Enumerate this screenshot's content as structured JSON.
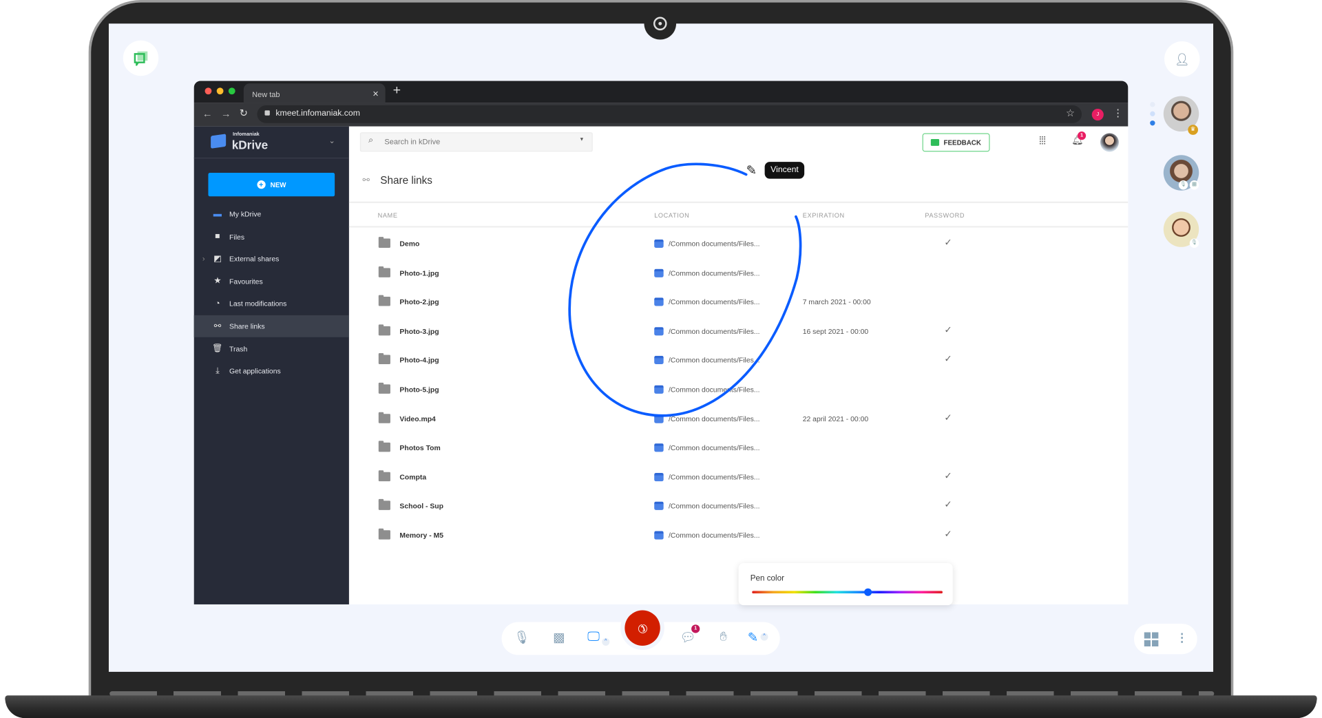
{
  "browser": {
    "tab_title": "New tab",
    "url": "kmeet.infomaniak.com",
    "profile_initial": "J"
  },
  "sidebar": {
    "brand_small": "Infomaniak",
    "brand": "kDrive",
    "new_label": "NEW",
    "items": [
      {
        "label": "My kDrive",
        "icon": "drive-icon"
      },
      {
        "label": "Files",
        "icon": "folder-icon"
      },
      {
        "label": "External shares",
        "icon": "shared-folder-icon"
      },
      {
        "label": "Favourites",
        "icon": "star-icon"
      },
      {
        "label": "Last modifications",
        "icon": "clock-icon"
      },
      {
        "label": "Share links",
        "icon": "link-icon",
        "active": true
      },
      {
        "label": "Trash",
        "icon": "trash-icon"
      },
      {
        "label": "Get applications",
        "icon": "download-icon"
      }
    ]
  },
  "header": {
    "search_placeholder": "Search in kDrive",
    "feedback_label": "FEEDBACK",
    "notification_count": "1"
  },
  "page": {
    "title": "Share links",
    "columns": [
      "NAME",
      "LOCATION",
      "EXPIRATION",
      "PASSWORD"
    ],
    "rows": [
      {
        "name": "Demo",
        "location": "/Common documents/Files...",
        "expiration": "",
        "password": true
      },
      {
        "name": "Photo-1.jpg",
        "location": "/Common documents/Files...",
        "expiration": "",
        "password": false
      },
      {
        "name": "Photo-2.jpg",
        "location": "/Common documents/Files...",
        "expiration": "7 march 2021 - 00:00",
        "password": false
      },
      {
        "name": "Photo-3.jpg",
        "location": "/Common documents/Files...",
        "expiration": "16 sept 2021 - 00:00",
        "password": true
      },
      {
        "name": "Photo-4.jpg",
        "location": "/Common documents/Files...",
        "expiration": "",
        "password": true
      },
      {
        "name": "Photo-5.jpg",
        "location": "/Common documents/Files...",
        "expiration": "",
        "password": false
      },
      {
        "name": "Video.mp4",
        "location": "/Common documents/Files...",
        "expiration": "22 april 2021 - 00:00",
        "password": true
      },
      {
        "name": "Photos Tom",
        "location": "/Common documents/Files...",
        "expiration": "",
        "password": false
      },
      {
        "name": "Compta",
        "location": "/Common documents/Files...",
        "expiration": "",
        "password": true
      },
      {
        "name": "School - Sup",
        "location": "/Common documents/Files...",
        "expiration": "",
        "password": true
      },
      {
        "name": "Memory - M5",
        "location": "/Common documents/Files...",
        "expiration": "",
        "password": true
      }
    ]
  },
  "annotation": {
    "cursor_user": "Vincent",
    "stroke_color": "#0a5cff"
  },
  "pen_popup": {
    "label": "Pen color",
    "hue_position": 0.61
  },
  "call_toolbar": {
    "chat_unread": "1",
    "hangup_color": "#d21f00"
  }
}
